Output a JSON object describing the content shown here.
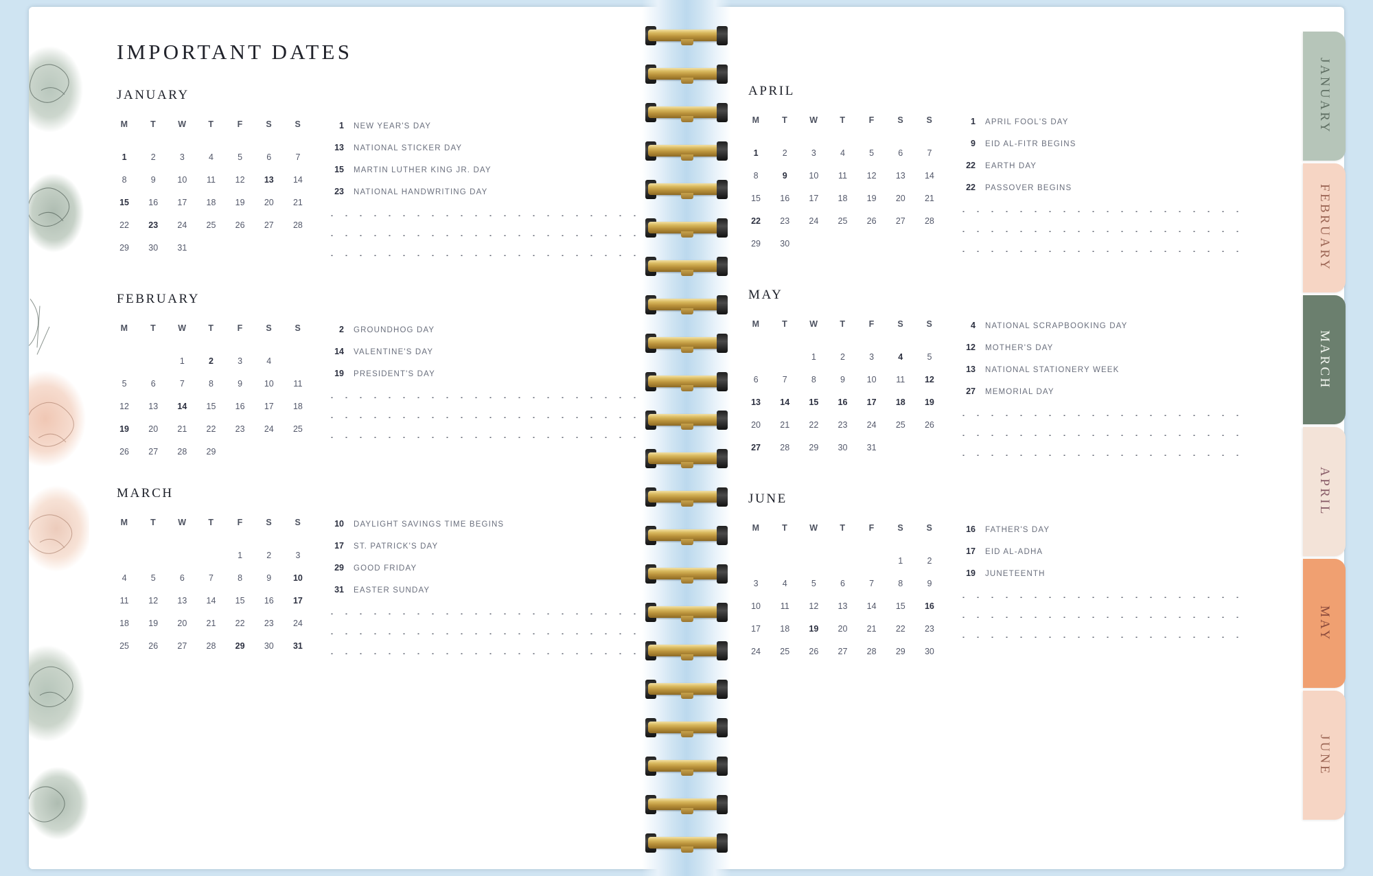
{
  "spread": {
    "title": "IMPORTANT DATES",
    "weekday_headers": [
      "M",
      "T",
      "W",
      "T",
      "F",
      "S",
      "S"
    ]
  },
  "left_page": {
    "months": [
      {
        "name": "JANUARY",
        "weeks": [
          [
            "1",
            "2",
            "3",
            "4",
            "5",
            "6",
            "7"
          ],
          [
            "8",
            "9",
            "10",
            "11",
            "12",
            "13",
            "14"
          ],
          [
            "15",
            "16",
            "17",
            "18",
            "19",
            "20",
            "21"
          ],
          [
            "22",
            "23",
            "24",
            "25",
            "26",
            "27",
            "28"
          ],
          [
            "29",
            "30",
            "31",
            "",
            "",
            "",
            ""
          ]
        ],
        "bold_days": [
          "1",
          "13",
          "15",
          "23"
        ],
        "events": [
          {
            "day": "1",
            "text": "NEW YEAR'S DAY"
          },
          {
            "day": "13",
            "text": "NATIONAL STICKER DAY"
          },
          {
            "day": "15",
            "text": "MARTIN LUTHER KING JR. DAY"
          },
          {
            "day": "23",
            "text": "NATIONAL HANDWRITING DAY"
          }
        ],
        "blank_lines": 3
      },
      {
        "name": "FEBRUARY",
        "weeks": [
          [
            "",
            "",
            "1",
            "2",
            "3",
            "4"
          ],
          [
            "5",
            "6",
            "7",
            "8",
            "9",
            "10",
            "11"
          ],
          [
            "12",
            "13",
            "14",
            "15",
            "16",
            "17",
            "18"
          ],
          [
            "19",
            "20",
            "21",
            "22",
            "23",
            "24",
            "25"
          ],
          [
            "26",
            "27",
            "28",
            "29",
            "",
            "",
            ""
          ]
        ],
        "bold_days": [
          "2",
          "14",
          "19"
        ],
        "events": [
          {
            "day": "2",
            "text": "GROUNDHOG DAY"
          },
          {
            "day": "14",
            "text": "VALENTINE'S DAY"
          },
          {
            "day": "19",
            "text": "PRESIDENT'S DAY"
          }
        ],
        "blank_lines": 3
      },
      {
        "name": "MARCH",
        "weeks": [
          [
            "",
            "",
            "",
            "",
            "1",
            "2",
            "3"
          ],
          [
            "4",
            "5",
            "6",
            "7",
            "8",
            "9",
            "10"
          ],
          [
            "11",
            "12",
            "13",
            "14",
            "15",
            "16",
            "17"
          ],
          [
            "18",
            "19",
            "20",
            "21",
            "22",
            "23",
            "24"
          ],
          [
            "25",
            "26",
            "27",
            "28",
            "29",
            "30",
            "31"
          ]
        ],
        "bold_days": [
          "10",
          "17",
          "29",
          "31"
        ],
        "events": [
          {
            "day": "10",
            "text": "DAYLIGHT SAVINGS TIME BEGINS"
          },
          {
            "day": "17",
            "text": "ST. PATRICK'S DAY"
          },
          {
            "day": "29",
            "text": "GOOD FRIDAY"
          },
          {
            "day": "31",
            "text": "EASTER SUNDAY"
          }
        ],
        "blank_lines": 3
      }
    ]
  },
  "right_page": {
    "months": [
      {
        "name": "APRIL",
        "weeks": [
          [
            "1",
            "2",
            "3",
            "4",
            "5",
            "6",
            "7"
          ],
          [
            "8",
            "9",
            "10",
            "11",
            "12",
            "13",
            "14"
          ],
          [
            "15",
            "16",
            "17",
            "18",
            "19",
            "20",
            "21"
          ],
          [
            "22",
            "23",
            "24",
            "25",
            "26",
            "27",
            "28"
          ],
          [
            "29",
            "30",
            "",
            "",
            "",
            "",
            ""
          ]
        ],
        "bold_days": [
          "1",
          "9",
          "22"
        ],
        "events": [
          {
            "day": "1",
            "text": "APRIL FOOL'S DAY"
          },
          {
            "day": "9",
            "text": "EID AL-FITR BEGINS"
          },
          {
            "day": "22",
            "text": "EARTH DAY"
          },
          {
            "day": "22",
            "text": "PASSOVER BEGINS"
          }
        ],
        "blank_lines": 3
      },
      {
        "name": "MAY",
        "weeks": [
          [
            "",
            "",
            "1",
            "2",
            "3",
            "4",
            "5"
          ],
          [
            "6",
            "7",
            "8",
            "9",
            "10",
            "11",
            "12"
          ],
          [
            "13",
            "14",
            "15",
            "16",
            "17",
            "18",
            "19"
          ],
          [
            "20",
            "21",
            "22",
            "23",
            "24",
            "25",
            "26"
          ],
          [
            "27",
            "28",
            "29",
            "30",
            "31",
            "",
            ""
          ]
        ],
        "bold_days": [
          "4",
          "12",
          "13",
          "14",
          "15",
          "16",
          "17",
          "18",
          "19",
          "27"
        ],
        "events": [
          {
            "day": "4",
            "text": "NATIONAL SCRAPBOOKING DAY"
          },
          {
            "day": "12",
            "text": "MOTHER'S DAY"
          },
          {
            "day": "13",
            "text": "NATIONAL STATIONERY WEEK"
          },
          {
            "day": "27",
            "text": "MEMORIAL DAY"
          }
        ],
        "blank_lines": 3
      },
      {
        "name": "JUNE",
        "weeks": [
          [
            "",
            "",
            "",
            "",
            "",
            "1",
            "2"
          ],
          [
            "3",
            "4",
            "5",
            "6",
            "7",
            "8",
            "9"
          ],
          [
            "10",
            "11",
            "12",
            "13",
            "14",
            "15",
            "16"
          ],
          [
            "17",
            "18",
            "19",
            "20",
            "21",
            "22",
            "23"
          ],
          [
            "24",
            "25",
            "26",
            "27",
            "28",
            "29",
            "30"
          ]
        ],
        "bold_days": [
          "16",
          "19"
        ],
        "events": [
          {
            "day": "16",
            "text": "FATHER'S DAY"
          },
          {
            "day": "17",
            "text": "EID AL-ADHA"
          },
          {
            "day": "19",
            "text": "JUNETEENTH"
          }
        ],
        "blank_lines": 3
      }
    ],
    "tabs": [
      {
        "label": "JANUARY",
        "bg": "#b6c5b9",
        "fg": "#5f6f63"
      },
      {
        "label": "FEBRUARY",
        "bg": "#f6d5c4",
        "fg": "#9c6655"
      },
      {
        "label": "MARCH",
        "bg": "#6b7f6e",
        "fg": "#f2f5ef"
      },
      {
        "label": "APRIL",
        "bg": "#f3e3d8",
        "fg": "#8a5f6a"
      },
      {
        "label": "MAY",
        "bg": "#f0a071",
        "fg": "#8a4a3c"
      },
      {
        "label": "JUNE",
        "bg": "#f6d5c4",
        "fg": "#9c6655"
      }
    ]
  }
}
